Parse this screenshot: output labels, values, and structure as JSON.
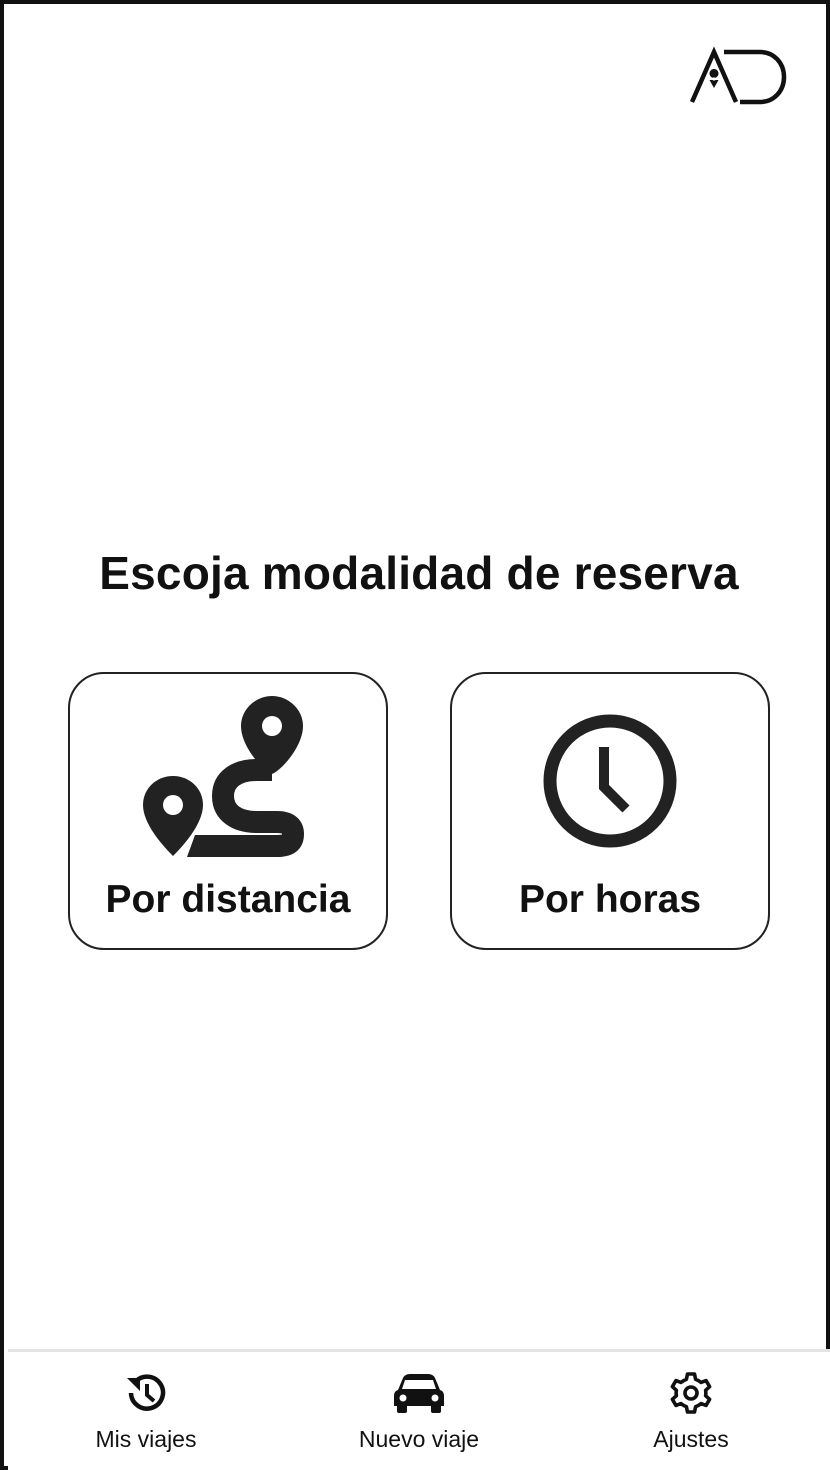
{
  "brand": {
    "logo_text": "AD",
    "logo_icon": "ad-logo-icon"
  },
  "main": {
    "title": "Escoja modalidad de reserva",
    "options": [
      {
        "label": "Por distancia",
        "icon": "route-icon"
      },
      {
        "label": "Por horas",
        "icon": "clock-icon"
      }
    ]
  },
  "tabbar": {
    "items": [
      {
        "label": "Mis viajes",
        "icon": "history-icon"
      },
      {
        "label": "Nuevo viaje",
        "icon": "car-icon"
      },
      {
        "label": "Ajustes",
        "icon": "gear-icon"
      }
    ]
  },
  "colors": {
    "ink": "#111111",
    "divider": "#e4e4e4",
    "background": "#ffffff"
  }
}
